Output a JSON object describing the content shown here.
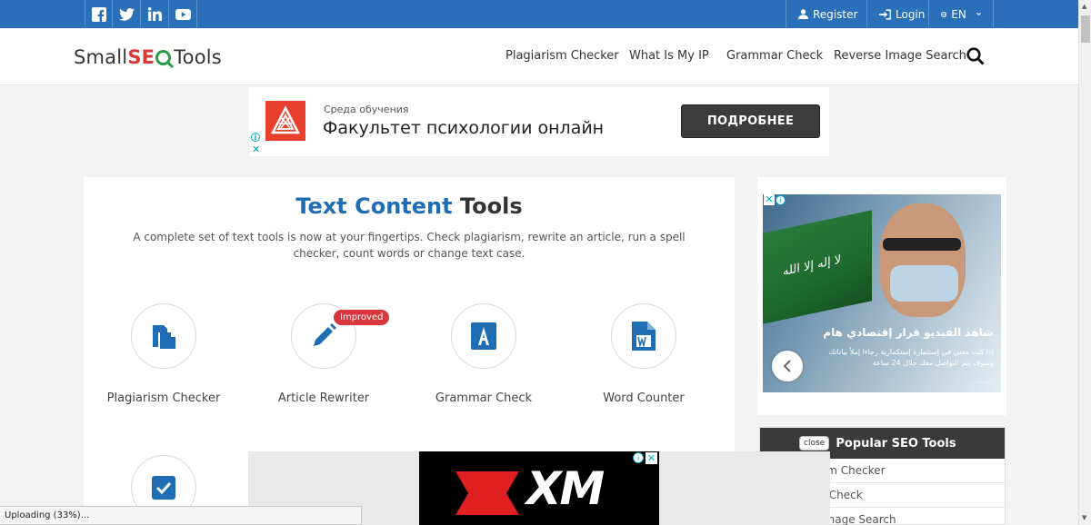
{
  "topbar": {
    "social": [
      {
        "name": "facebook-icon"
      },
      {
        "name": "twitter-icon"
      },
      {
        "name": "linkedin-icon"
      },
      {
        "name": "youtube-icon"
      }
    ],
    "register": "Register",
    "login": "Login",
    "language": "EN",
    "color": "#2a70b8"
  },
  "header": {
    "logo": {
      "part1": "Small",
      "part2": "SE",
      "part3": "Tools"
    },
    "nav": [
      "Plagiarism Checker",
      "What Is My IP",
      "Grammar Check",
      "Reverse Image Search"
    ]
  },
  "ad_banner": {
    "small_text": "Среда обучения",
    "big_text": "Факультет психологии онлайн",
    "button": "ПОДРОБНЕЕ"
  },
  "main": {
    "title_blue": "Text Content",
    "title_rest": "Tools",
    "subtitle": "A complete set of text tools is now at your fingertips. Check plagiarism, rewrite an article, run a spell checker, count words or change text case.",
    "tools": [
      {
        "label": "Plagiarism Checker",
        "icon": "copy-icon"
      },
      {
        "label": "Article Rewriter",
        "icon": "pencil-icon"
      },
      {
        "label": "Grammar Check",
        "icon": "grammar-a-icon"
      },
      {
        "label": "Word Counter",
        "icon": "word-doc-icon"
      }
    ],
    "badge": "Improved"
  },
  "right_ad": {
    "arabic_title": "شاهد الفيديو قرار إقتصادي هام",
    "arabic_desc": "إذا كنت معني في إستثمارة إستكمارية رجاءا إملأ بياناتك وسوف يتم التواصل معك خلال 24 ساعة",
    "source": "المباشر",
    "flag_text": "لا إله إلا الله"
  },
  "popular": {
    "title": "Popular SEO Tools",
    "close": "close",
    "items": [
      "sm Checker",
      "r Check",
      "Image Search"
    ]
  },
  "bottom_ad": {
    "brand": "XM"
  },
  "status_bar": "Uploading (33%)..."
}
